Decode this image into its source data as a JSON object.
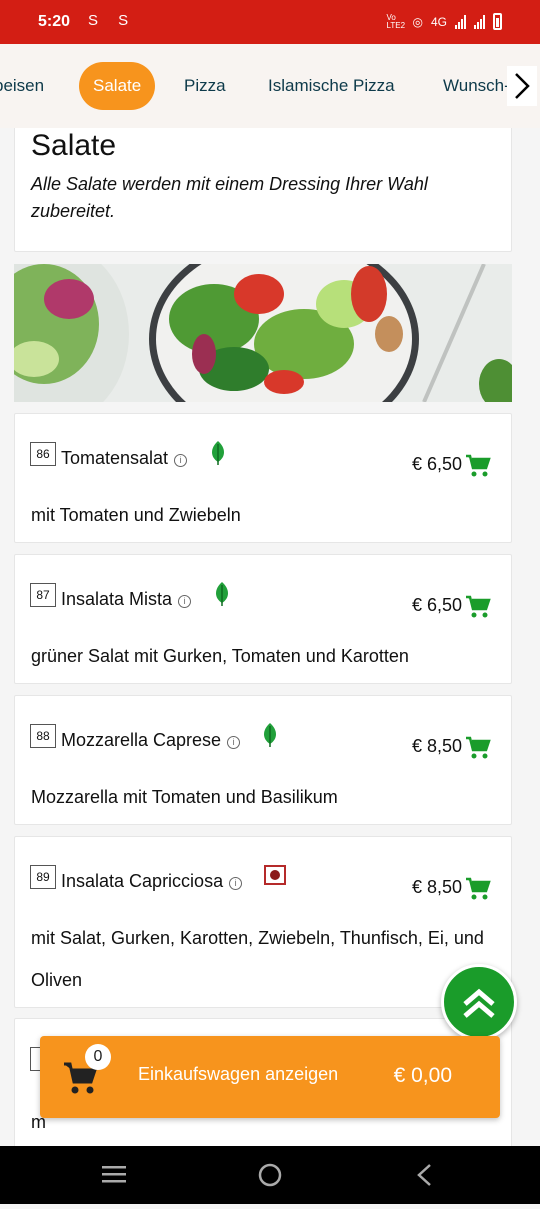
{
  "status_bar": {
    "time": "5:20",
    "left_icons": "S S",
    "network_label": "4G",
    "carrier_label": "Vo LTE2"
  },
  "categories": {
    "items": [
      {
        "label": "peisen",
        "active": false
      },
      {
        "label": "Salate",
        "active": true
      },
      {
        "label": "Pizza",
        "active": false
      },
      {
        "label": "Islamische Pizza",
        "active": false
      },
      {
        "label": "Wunsch-",
        "active": false
      }
    ],
    "next_icon": "chevron-right-icon"
  },
  "section": {
    "title": "Salate",
    "subtitle": "Alle Salate werden mit einem Dressing Ihrer Wahl zubereitet."
  },
  "menu_items": [
    {
      "number": "86",
      "name": "Tomatensalat",
      "badge": "vegetarian-leaf-icon",
      "price": "€ 6,50",
      "description": "mit Tomaten und Zwiebeln"
    },
    {
      "number": "87",
      "name": "Insalata Mista",
      "badge": "vegetarian-leaf-icon",
      "price": "€ 6,50",
      "description": "grüner Salat mit Gurken, Tomaten und Karotten"
    },
    {
      "number": "88",
      "name": "Mozzarella Caprese",
      "badge": "vegetarian-leaf-icon",
      "price": "€ 8,50",
      "description": "Mozzarella mit Tomaten und Basilikum"
    },
    {
      "number": "89",
      "name": "Insalata Capricciosa",
      "badge": "non-vegetarian-icon",
      "price": "€ 8,50",
      "description": "mit Salat, Gurken, Karotten, Zwiebeln, Thunfisch, Ei, und Oliven"
    },
    {
      "number": "9",
      "name": "",
      "badge": "",
      "price": "",
      "description": "m"
    }
  ],
  "cart_bar": {
    "count": "0",
    "label": "Einkaufswagen anzeigen",
    "total": "€ 0,00"
  },
  "colors": {
    "brand_red": "#d31e14",
    "accent_orange": "#f7941d",
    "green": "#1a9c2a"
  }
}
